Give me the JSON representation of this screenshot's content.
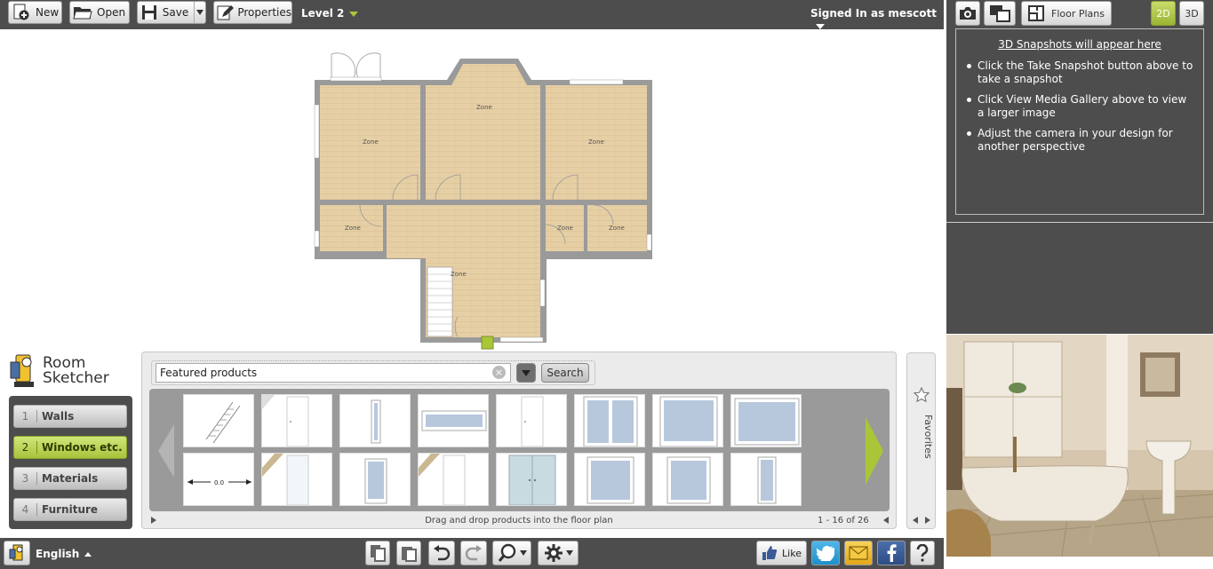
{
  "toolbar": {
    "new_label": "New",
    "open_label": "Open",
    "save_label": "Save",
    "properties_label": "Properties",
    "level_label": "Level 2",
    "signed_in_label": "Signed In as mescott"
  },
  "right_panel": {
    "floor_plans_label": "Floor Plans",
    "mode_2d": "2D",
    "mode_3d": "3D",
    "snapshot_heading": "3D Snapshots will appear here",
    "tips": [
      "Click the Take Snapshot button above to take a snapshot",
      "Click View Media Gallery above to view a larger image",
      "Adjust the camera in your design for another perspective"
    ]
  },
  "floorplan": {
    "zone_label": "Zone",
    "door_dimension": "0.0"
  },
  "logo": {
    "line1": "Room",
    "line2": "Sketcher"
  },
  "sidebar": {
    "items": [
      {
        "num": "1",
        "label": "Walls",
        "active": false
      },
      {
        "num": "2",
        "label": "Windows etc.",
        "active": true
      },
      {
        "num": "3",
        "label": "Materials",
        "active": false
      },
      {
        "num": "4",
        "label": "Furniture",
        "active": false
      }
    ]
  },
  "products": {
    "search_value": "Featured products",
    "search_button": "Search",
    "hint": "Drag and drop products into the floor plan",
    "count": "1 - 16 of 26",
    "favorites_label": "Favorites"
  },
  "bottom": {
    "language": "English",
    "like_label": "Like"
  },
  "colors": {
    "toolbar_bg": "#4d4d4d",
    "accent_green": "#a9c639",
    "floor_wood": "#e6cfa5",
    "wall_gray": "#9a9a9a"
  }
}
